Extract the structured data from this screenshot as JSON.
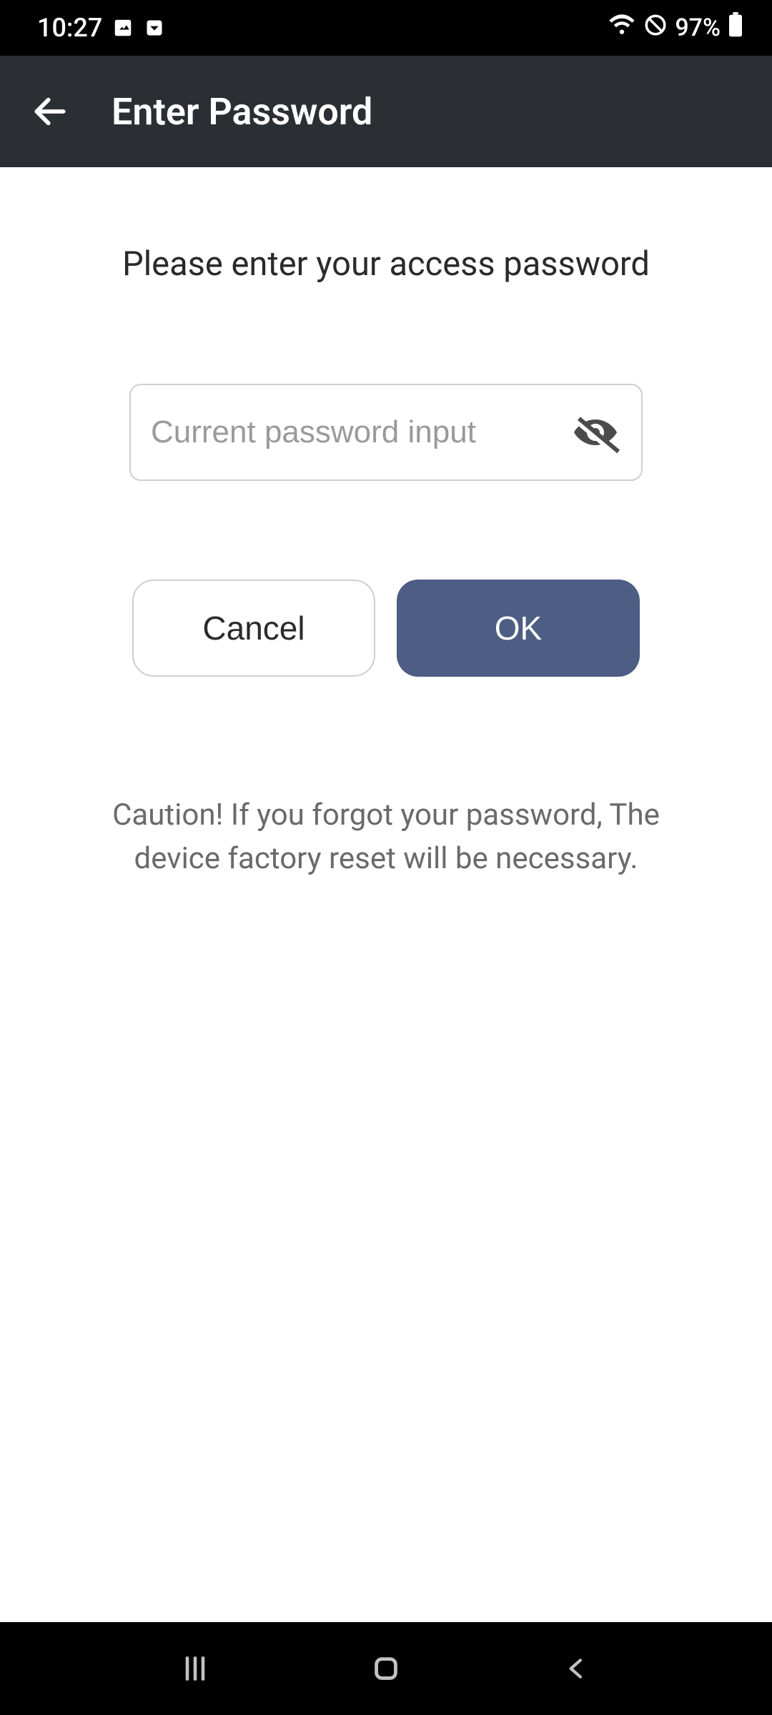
{
  "statusBar": {
    "time": "10:27",
    "battery": "97%"
  },
  "appBar": {
    "title": "Enter Password"
  },
  "content": {
    "prompt": "Please enter your access password",
    "passwordPlaceholder": "Current password input",
    "cancelLabel": "Cancel",
    "okLabel": "OK",
    "caution": "Caution! If you forgot your password, The device factory reset will be necessary."
  }
}
